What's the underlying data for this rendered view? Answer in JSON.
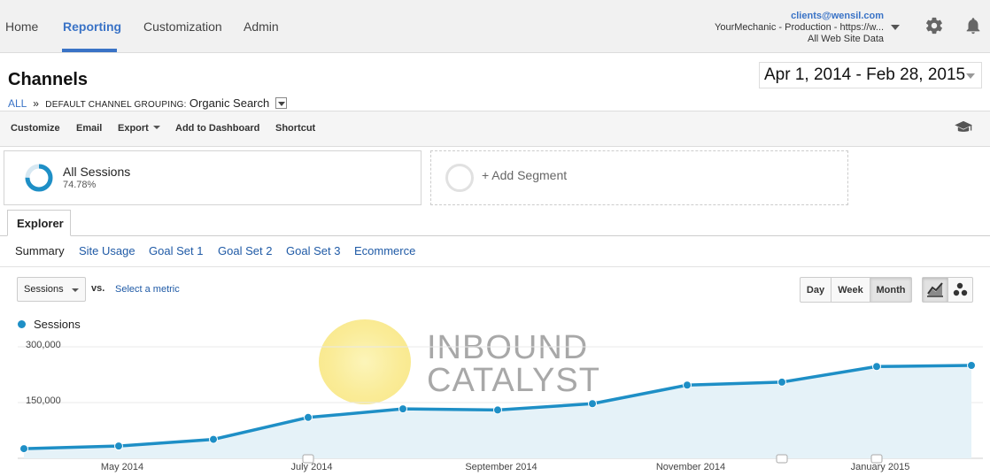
{
  "nav": {
    "tabs": [
      {
        "label": "Home"
      },
      {
        "label": "Reporting"
      },
      {
        "label": "Customization"
      },
      {
        "label": "Admin"
      }
    ],
    "account": {
      "email": "clients@wensil.com",
      "property": "YourMechanic - Production - https://w...",
      "view": "All Web Site Data"
    },
    "icons": {
      "settings": "gear-icon",
      "notifications": "bell-icon"
    }
  },
  "header": {
    "title": "Channels",
    "breadcrumb": {
      "all": "ALL",
      "separator": "»",
      "grouping_label": "DEFAULT CHANNEL GROUPING:",
      "grouping_value": "Organic Search"
    },
    "date_range": "Apr 1, 2014 - Feb 28, 2015"
  },
  "toolbar": {
    "customize": "Customize",
    "email": "Email",
    "export": "Export",
    "add_to_dashboard": "Add to Dashboard",
    "shortcut": "Shortcut",
    "help_icon": "graduation-cap-icon"
  },
  "segments": {
    "active": {
      "name": "All Sessions",
      "percent": "74.78%",
      "percent_value": 0.7478
    },
    "add_label": "+ Add Segment"
  },
  "explorer": {
    "tab": "Explorer",
    "subtabs": [
      {
        "label": "Summary"
      },
      {
        "label": "Site Usage"
      },
      {
        "label": "Goal Set 1"
      },
      {
        "label": "Goal Set 2"
      },
      {
        "label": "Goal Set 3"
      },
      {
        "label": "Ecommerce"
      }
    ]
  },
  "chart_controls": {
    "metric": "Sessions",
    "vs": "vs.",
    "select_metric": "Select a metric",
    "periods": [
      {
        "label": "Day"
      },
      {
        "label": "Week"
      },
      {
        "label": "Month"
      }
    ],
    "active_period": "Month",
    "views": [
      "line-chart-icon",
      "motion-chart-icon"
    ]
  },
  "watermark": {
    "line1": "INBOUND",
    "line2": "CATALYST"
  },
  "chart_data": {
    "type": "area",
    "legend": [
      "Sessions"
    ],
    "color": "#1e8fc6",
    "fill_color": "#e5f2f8",
    "ylim": [
      0,
      300000
    ],
    "yticks": [
      {
        "label": "300,000",
        "value": 300000
      },
      {
        "label": "150,000",
        "value": 150000
      }
    ],
    "xticks": [
      "May 2014",
      "July 2014",
      "September 2014",
      "November 2014",
      "January 2015"
    ],
    "series": [
      {
        "name": "Sessions",
        "x": [
          "Apr 2014",
          "May 2014",
          "Jun 2014",
          "Jul 2014",
          "Aug 2014",
          "Sep 2014",
          "Oct 2014",
          "Nov 2014",
          "Dec 2014",
          "Jan 2015",
          "Feb 2015"
        ],
        "values": [
          26000,
          33000,
          51000,
          110000,
          133000,
          130000,
          147000,
          197000,
          205000,
          247000,
          250000
        ]
      }
    ]
  }
}
